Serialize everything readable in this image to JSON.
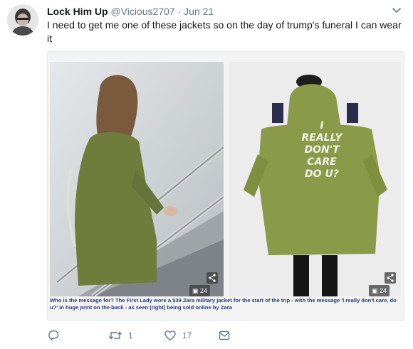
{
  "tweet": {
    "display_name": "Lock Him Up",
    "handle": "@Vicious2707",
    "separator": "·",
    "timestamp": "Jun 21",
    "text": "I need to get me one of these jackets so on the day of trump's funeral I can wear it"
  },
  "media": {
    "left_photo_badge": "24",
    "right_photo_badge": "24",
    "jacket_slogan": [
      "I",
      "REALLY",
      "DON'T",
      "CARE",
      "DO U?"
    ],
    "caption": "Who is the message for? The First Lady wore a $39 Zara military jacket for the start of the trip - with the message 'I really don't care, do u?' in huge print on the back - as seen (right) being sold online by Zara"
  },
  "actions": {
    "reply_count": "",
    "retweet_count": "1",
    "like_count": "17"
  },
  "colors": {
    "secondary_text": "#657786",
    "jacket_green": "#7f8f3e",
    "caption_blue": "#253b7a"
  }
}
